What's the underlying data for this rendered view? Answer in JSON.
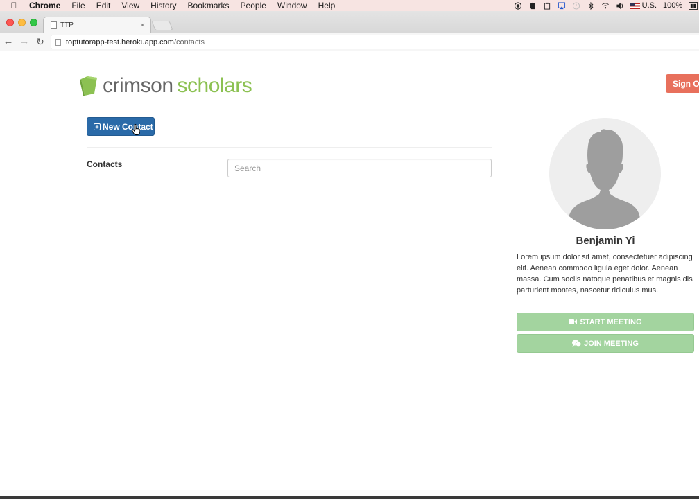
{
  "menubar": {
    "app_name": "Chrome",
    "items": [
      "File",
      "Edit",
      "View",
      "History",
      "Bookmarks",
      "People",
      "Window",
      "Help"
    ],
    "input_source": "U.S.",
    "battery": "100%"
  },
  "browser": {
    "tab_title": "TTP",
    "url_host": "toptutorapp-test.herokuapp.com",
    "url_path": "/contacts"
  },
  "brand": {
    "name_part1": "crimson",
    "name_part2": "scholars",
    "primary_color": "#8cc152",
    "text_color": "#666666"
  },
  "header": {
    "sign_out_label": "Sign Out"
  },
  "contacts": {
    "new_contact_label": "New Contact",
    "section_label": "Contacts",
    "search_placeholder": "Search"
  },
  "profile": {
    "name": "Benjamin Yi",
    "bio": "Lorem ipsum dolor sit amet, consectetuer adipiscing elit. Aenean commodo ligula eget dolor. Aenean massa. Cum sociis natoque penatibus et magnis dis parturient montes, nascetur ridiculus mus.",
    "start_meeting_label": "START MEETING",
    "join_meeting_label": "JOIN MEETING"
  },
  "colors": {
    "sign_out": "#e8705c",
    "new_contact": "#2a6aa8",
    "meeting_buttons": "#a3d49f"
  }
}
